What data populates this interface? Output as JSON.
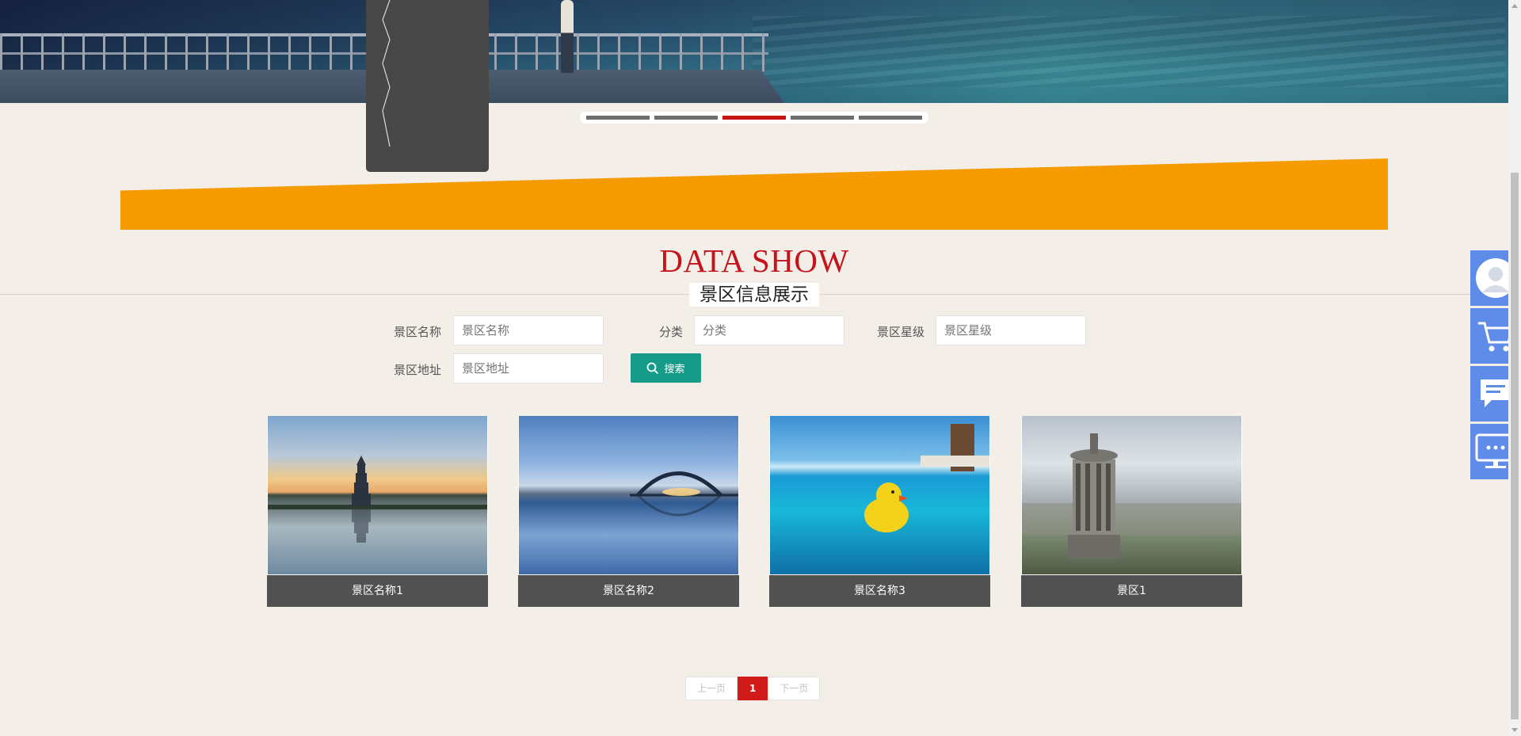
{
  "slider": {
    "count": 5,
    "active_index": 2
  },
  "section": {
    "title_en": "DATA SHOW",
    "title_cn": "景区信息展示"
  },
  "search": {
    "name_label": "景区名称",
    "name_placeholder": "景区名称",
    "category_label": "分类",
    "category_placeholder": "分类",
    "star_label": "景区星级",
    "star_placeholder": "景区星级",
    "address_label": "景区地址",
    "address_placeholder": "景区地址",
    "button_label": "搜索"
  },
  "cards": [
    {
      "caption": "景区名称1",
      "image": "pagoda-lake-sunset"
    },
    {
      "caption": "景区名称2",
      "image": "arch-bridge-reflection"
    },
    {
      "caption": "景区名称3",
      "image": "rubber-duck-pool"
    },
    {
      "caption": "景区1",
      "image": "monument-city-view"
    }
  ],
  "pagination": {
    "prev_label": "上一页",
    "current": "1",
    "next_label": "下一页"
  },
  "float_toolbar": [
    "user-icon",
    "cart-icon",
    "chat-icon",
    "monitor-icon"
  ],
  "colors": {
    "accent_red": "#c4131b",
    "orange": "#f59b00",
    "search_green": "#169b89",
    "float_blue": "#5f8ce8",
    "page_bg": "#f3eee8"
  }
}
